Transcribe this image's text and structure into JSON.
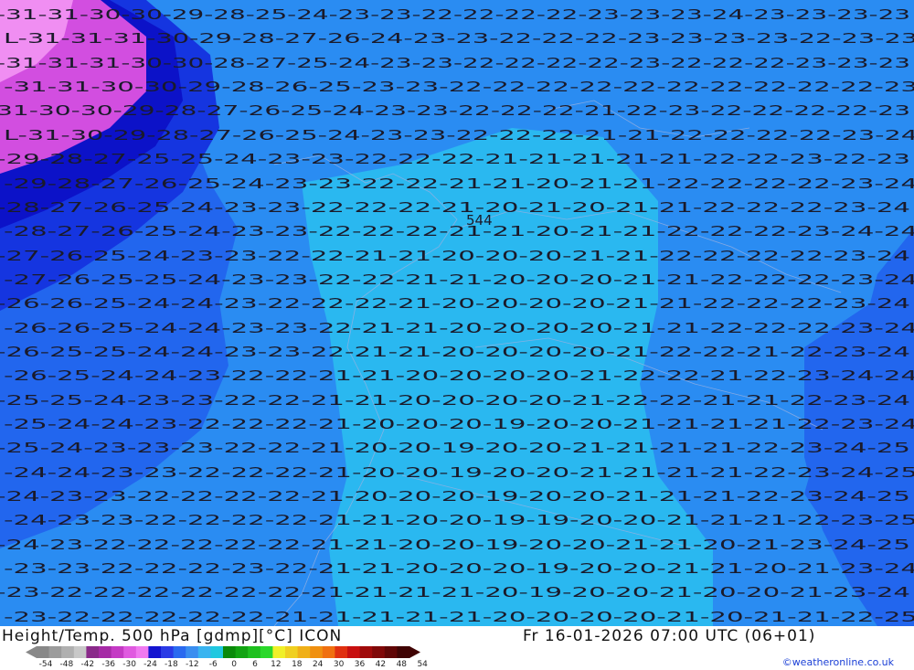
{
  "header": {
    "title": "Height/Temp. 500 hPa [gdmp][°C] ICON",
    "valid_time": "Fr 16-01-2026 07:00 UTC (06+01)",
    "credit": "©weatheronline.co.uk"
  },
  "map": {
    "field_label": "544",
    "region_colors": {
      "lt-20": "#2ab8f0",
      "lt-22": "#2a8cf2",
      "lt-25": "#2266ee",
      "lt-27": "#1535e0",
      "lt-29": "#0c12c8",
      "lt-31": "#d24ee0",
      "pink": "#f08ef2"
    },
    "contour_rows": [
      "-31-31-30-30-29-28-25-24-23-23-22-22-22-22-23-23-23-24-23-23-23-23",
      "L-31-31-31-30-29-28-27-26-24-23-23-22-22-22-23-23-23-23-22-23-23",
      "-31-31-31-30-30-28-27-25-24-23-23-22-22-22-22-23-22-22-22-23-23-23",
      "-31-31-30-30-29-28-26-25-23-23-22-22-22-22-22-22-22-22-22-22-23",
      "31-30-30-29-28-27-26-25-24-23-23-22-22-22-21-22-23-22-22-22-22-23",
      "L-31-30-29-28-27-26-25-24-23-23-22-22-22-21-21-22-22-22-22-23-24",
      "-29-28-27-25-25-24-23-23-22-22-22-21-21-21-21-21-22-22-23-22-23",
      "-29-28-27-26-25-24-23-23-22-22-21-21-20-21-21-22-22-22-22-23-24",
      "-28-27-26-25-24-23-23-22-22-22-21-20-21-20-21-21-22-22-22-23-24",
      "-28-27-26-25-24-23-23-22-22-22-21-21-20-21-21-22-22-22-23-24-24",
      "-27-26-25-24-23-23-22-22-21-21-20-20-20-21-21-22-22-22-22-23-24",
      "-27-26-25-25-24-23-23-22-22-21-21-20-20-20-21-21-22-22-22-23-24",
      "-26-26-25-24-24-23-22-22-22-21-20-20-20-20-21-21-22-22-22-23-24",
      "-26-26-25-24-24-23-23-22-21-21-20-20-20-20-21-21-22-22-22-23-24",
      "-26-25-25-24-24-23-23-22-21-21-20-20-20-20-21-22-22-21-22-23-24",
      "-26-25-24-24-23-22-22-21-21-20-20-20-20-21-22-22-21-22-23-24-24",
      "-25-25-24-23-23-22-22-21-21-20-20-20-20-21-22-22-21-21-22-23-24",
      "-25-24-24-23-22-22-22-21-20-20-20-19-20-20-21-21-21-21-22-23-24",
      "-25-24-23-23-23-22-22-21-20-20-19-20-20-21-21-21-21-22-23-24-25",
      "-24-24-23-23-22-22-22-21-20-20-19-20-20-21-21-21-21-22-23-24-25",
      "-24-23-23-22-22-22-22-21-20-20-20-19-20-20-21-21-21-22-23-24-25",
      "-24-23-23-22-22-22-22-21-21-20-20-19-19-20-20-21-21-21-22-23-25",
      "-24-23-22-22-22-22-22-21-21-20-20-19-20-20-21-21-20-21-23-24-25",
      "-23-23-22-22-22-23-22-21-21-20-20-20-19-20-20-21-21-20-21-23-24",
      "-23-22-22-22-22-22-22-21-21-21-21-20-19-20-20-21-20-20-21-23-24",
      "-23-22-22-22-22-22-21-21-21-21-21-20-20-20-20-21-20-21-21-22-25"
    ]
  },
  "colorbar": {
    "ticks": [
      "-54",
      "-48",
      "-42",
      "-36",
      "-30",
      "-24",
      "-18",
      "-12",
      "-6",
      "0",
      "6",
      "12",
      "18",
      "24",
      "30",
      "36",
      "42",
      "48",
      "54"
    ],
    "colors": [
      "#888888",
      "#9c9c9c",
      "#b0b0b0",
      "#c8c8c8",
      "#8a2a8a",
      "#a62aa6",
      "#c43ac4",
      "#e05ae0",
      "#f07af0",
      "#1414d0",
      "#2a3ae6",
      "#2a6af0",
      "#3a8ef0",
      "#3ab4f0",
      "#20c8e0",
      "#0a8a0a",
      "#12a412",
      "#1ec01e",
      "#2ad82a",
      "#f0f028",
      "#f0d020",
      "#f0b018",
      "#f09010",
      "#f07010",
      "#e03010",
      "#c81010",
      "#a00a0a",
      "#800808",
      "#600606",
      "#400404"
    ]
  }
}
